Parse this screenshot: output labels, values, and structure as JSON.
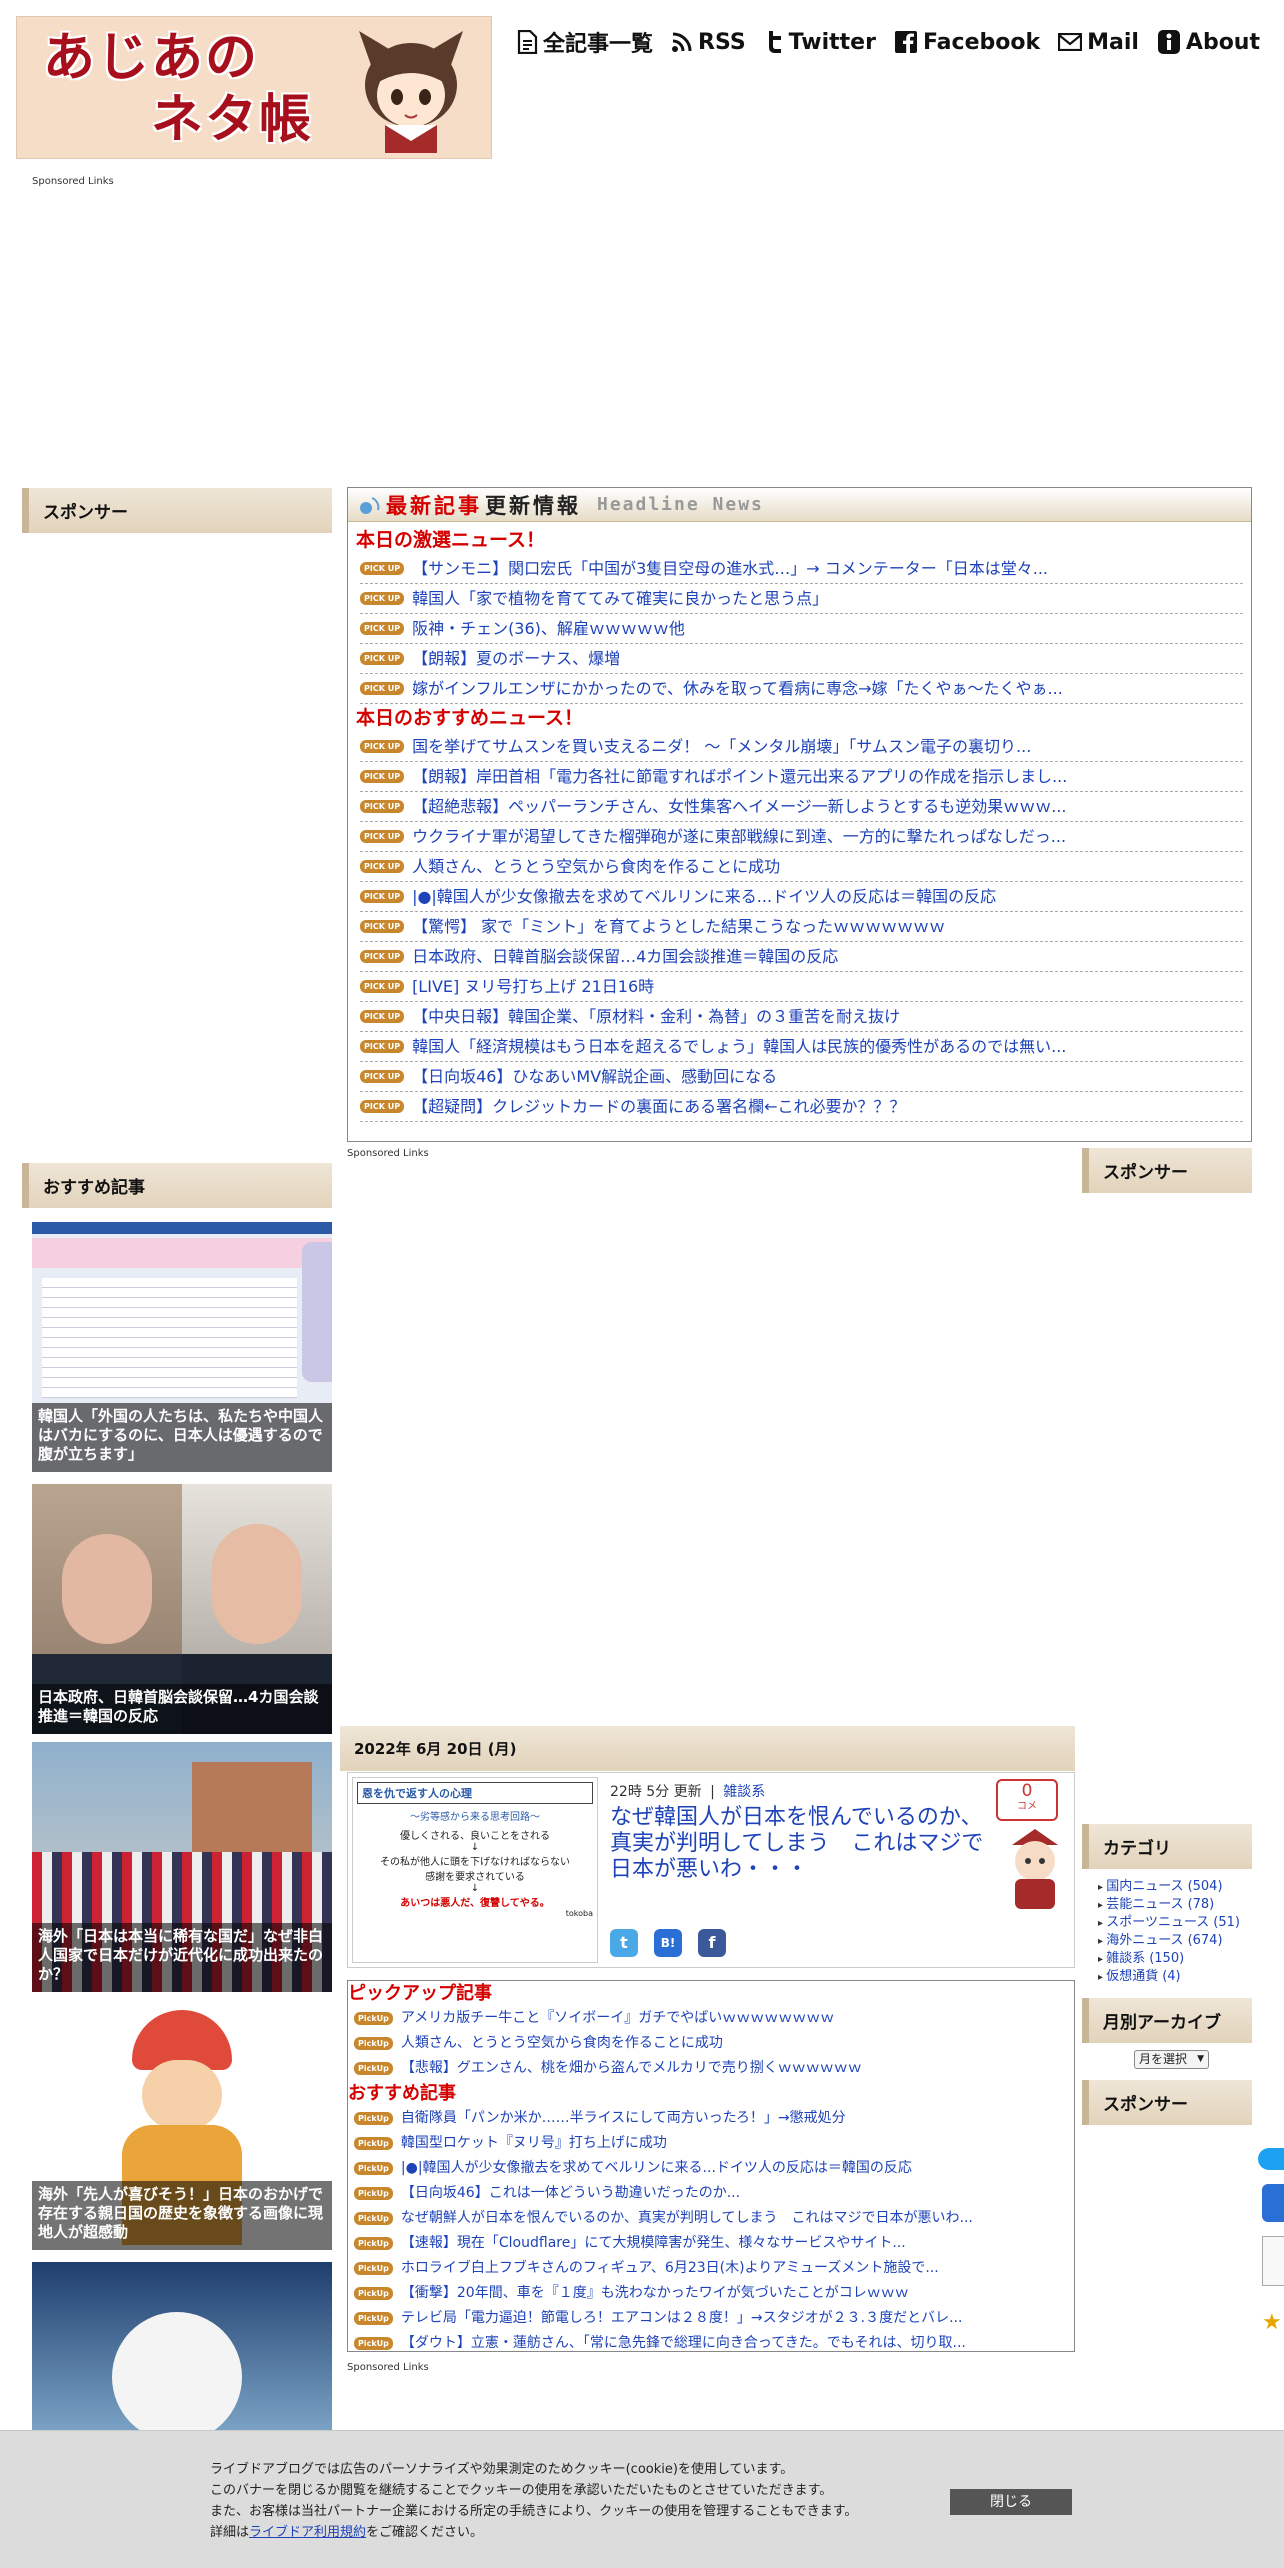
{
  "logo": {
    "title_line1": "あじあの",
    "title_line2": "ネタ帳"
  },
  "nav": [
    {
      "label": "全記事一覧",
      "icon": "document-icon"
    },
    {
      "label": "RSS",
      "icon": "rss-icon"
    },
    {
      "label": "Twitter",
      "icon": "twitter-icon"
    },
    {
      "label": "Facebook",
      "icon": "facebook-icon"
    },
    {
      "label": "Mail",
      "icon": "mail-icon"
    },
    {
      "label": "About",
      "icon": "info-icon"
    }
  ],
  "sponsored_label": "Sponsored Links",
  "sidebar_left": {
    "sponsor_title": "スポンサー",
    "recommend_title": "おすすめ記事",
    "cards": [
      {
        "caption": "韓国人「外国の人たちは、私たちや中国人はバカにするのに、日本人は優遇するので腹が立ちます」"
      },
      {
        "caption": "日本政府、日韓首脳会談保留…4カ国会談推進＝韓国の反応"
      },
      {
        "caption": "海外「日本は本当に稀有な国だ」なぜ非白人国家で日本だけが近代化に成功出来たのか？"
      },
      {
        "caption": "海外「先人が喜びそう！」日本のおかげで存在する親日国の歴史を象徴する画像に現地人が超感動"
      },
      {
        "caption": ""
      }
    ]
  },
  "news": {
    "header_red": "最新記事",
    "header_black": "更新情報",
    "header_en": "Headline News",
    "pick_label": "PICK UP",
    "section1": "本日の激選ニュース！",
    "section1_items": [
      "【サンモニ】関口宏氏「中国が3隻目空母の進水式…」→ コメンテーター「日本は堂々...",
      "韓国人「家で植物を育ててみて確実に良かったと思う点」",
      "阪神・チェン(36)、解雇ｗｗｗｗｗ他",
      "【朗報】夏のボーナス、爆増",
      "嫁がインフルエンザにかかったので、休みを取って看病に専念→嫁「たくやぁ～たくやぁ..."
    ],
    "section2": "本日のおすすめニュース！",
    "section2_items": [
      "国を挙げてサムスンを買い支えるニダ！ 〜「メンタル崩壊」「サムスン電子の裏切り...",
      "【朗報】岸田首相「電力各社に節電すればポイント還元出来るアプリの作成を指示しまし...",
      "【超絶悲報】ペッパーランチさん、女性集客へイメージ一新しようとするも逆効果ｗｗｗ...",
      "ウクライナ軍が渇望してきた榴弾砲が遂に東部戦線に到達、一方的に撃たれっぱなしだっ...",
      "人類さん、とうとう空気から食肉を作ることに成功",
      "|●|韓国人が少女像撤去を求めてベルリンに来る...ドイツ人の反応は＝韓国の反応",
      "【驚愕】 家で「ミント」を育てようとした結果こうなったｗｗｗｗｗｗｗ",
      "日本政府、日韓首脳会談保留…4カ国会談推進＝韓国の反応",
      "[LIVE] ヌリ号打ち上げ 21日16時",
      "【中央日報】韓国企業、「原材料・金利・為替」の３重苦を耐え抜け",
      "韓国人「経済規模はもう日本を超えるでしょう」韓国人は民族的優秀性があるのでは無い...",
      "【日向坂46】ひなあいMV解説企画、感動回になる",
      "【超疑問】クレジットカードの裏面にある署名欄←これ必要か？？？"
    ]
  },
  "sidebar_right": {
    "sponsor_title": "スポンサー",
    "category_title": "カテゴリ",
    "categories": [
      {
        "name": "国内ニュース",
        "count": "(504)"
      },
      {
        "name": "芸能ニュース",
        "count": "(78)"
      },
      {
        "name": "スポーツニュース",
        "count": "(51)"
      },
      {
        "name": "海外ニュース",
        "count": "(674)"
      },
      {
        "name": "雑談系",
        "count": "(150)"
      },
      {
        "name": "仮想通貨",
        "count": "(4)"
      }
    ],
    "archive_title": "月別アーカイブ",
    "archive_select": "月を選択",
    "sponsor2_title": "スポンサー"
  },
  "article": {
    "date": "2022年 6月 20日 (月)",
    "time": "22時 5分 更新",
    "separator": "|",
    "category": "雑談系",
    "title": "なぜ韓国人が日本を恨んでいるのか、真実が判明してしまう　これはマジで日本が悪いわ・・・",
    "comment_count": "0",
    "comment_label": "コメ",
    "thumb_title": "恩を仇で返す人の心理",
    "thumb_sub": "～劣等感から来る思考回路～",
    "thumb_l1": "優しくされる、良いことをされる",
    "thumb_arrow": "↓",
    "thumb_l2": "その私が他人に頭を下げなければならない",
    "thumb_l3": "感謝を要求されている",
    "thumb_l4": "あいつは悪人だ、復讐してやる。",
    "thumb_credit": "tokoba"
  },
  "pickup": {
    "label": "PickUp",
    "section1": "ピックアップ記事",
    "section1_items": [
      "アメリカ版チー牛こと『ソイボーイ』ガチでやばいｗｗｗｗｗｗｗｗ",
      "人類さん、とうとう空気から食肉を作ることに成功",
      "【悲報】グエンさん、桃を畑から盗んでメルカリで売り捌くｗｗｗｗｗｗ"
    ],
    "section2": "おすすめ記事",
    "section2_items": [
      "自衛隊員「パンか米か……半ライスにして両方いったろ！」→懲戒処分",
      "韓国型ロケット『ヌリ号』打ち上げに成功",
      "|●|韓国人が少女像撤去を求めてベルリンに来る...ドイツ人の反応は＝韓国の反応",
      "【日向坂46】これは一体どういう勘違いだったのか...",
      "なぜ朝鮮人が日本を恨んでいるのか、真実が判明してしまう　これはマジで日本が悪いわ...",
      "【速報】現在「Cloudflare」にて大規模障害が発生、様々なサービスやサイト...",
      "ホロライブ白上フブキさんのフィギュア、6月23日(木)よりアミューズメント施設で...",
      "【衝撃】20年間、車を『１度』も洗わなかったワイが気づいたことがコレｗｗｗ",
      "テレビ局「電力逼迫！節電しろ！エアコンは２８度！」→スタジオが２３.３度だとバレ...",
      "【ダウト】立憲・蓮舫さん、「常に急先鋒で総理に向き合ってきた。でもそれは、切り取..."
    ]
  },
  "cookie": {
    "line1": "ライブドアブログでは広告のパーソナライズや効果測定のためクッキー(cookie)を使用しています。",
    "line2": "このバナーを閉じるか閲覧を継続することでクッキーの使用を承認いただいたものとさせていただきます。",
    "line3": "また、お客様は当社パートナー企業における所定の手続きにより、クッキーの使用を管理することもできます。",
    "line4_pre": "詳細は",
    "line4_link": "ライブドア利用規約",
    "line4_post": "をご確認ください。",
    "close_label": "閉じる"
  },
  "colors": {
    "accent_red": "#d40000",
    "link_blue": "#1e43b8",
    "pick_orange": "#c8872c",
    "header_beige": "#e6dac4"
  }
}
